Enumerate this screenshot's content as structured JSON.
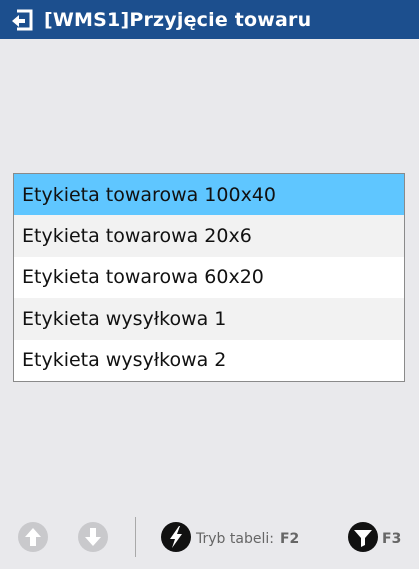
{
  "window": {
    "title": "[WMS1]Przyjęcie towaru",
    "title_bar_color": "#1c4f8e",
    "icon": "return-arrow-icon"
  },
  "list": {
    "selected_index": 0,
    "selected_color": "#5fc6ff",
    "items": [
      {
        "label": "Etykieta towarowa 100x40"
      },
      {
        "label": "Etykieta towarowa 20x6"
      },
      {
        "label": "Etykieta towarowa 60x20"
      },
      {
        "label": "Etykieta wysyłkowa 1"
      },
      {
        "label": "Etykieta wysyłkowa 2"
      }
    ]
  },
  "toolbar": {
    "up": {
      "icon": "arrow-up-icon",
      "enabled": false
    },
    "down": {
      "icon": "arrow-down-icon",
      "enabled": false
    },
    "table_mode": {
      "icon": "lightning-icon",
      "label": "Tryb tabeli:",
      "key": "F2"
    },
    "filter": {
      "icon": "filter-icon",
      "key": "F3"
    }
  }
}
